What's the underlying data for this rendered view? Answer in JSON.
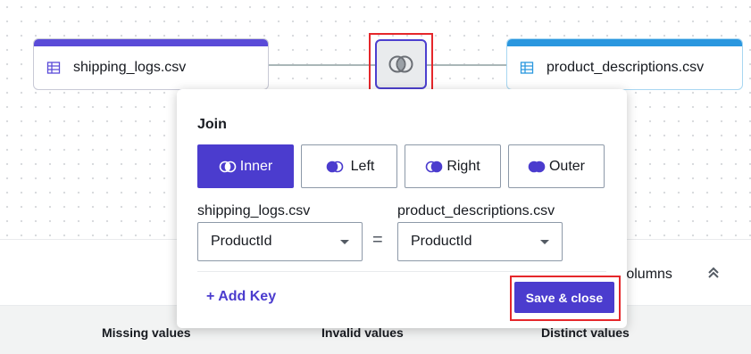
{
  "canvas": {
    "left_node": {
      "name": "shipping_logs.csv",
      "icon": "table-icon"
    },
    "right_node": {
      "name": "product_descriptions.csv",
      "icon": "table-icon"
    },
    "join_icon": "inner-join-icon"
  },
  "background_panel": {
    "columns_text": "d columns",
    "stats": [
      "Missing values",
      "Invalid values",
      "Distinct values"
    ]
  },
  "join_popover": {
    "title": "Join",
    "types": [
      {
        "label": "Inner",
        "selected": true
      },
      {
        "label": "Left",
        "selected": false
      },
      {
        "label": "Right",
        "selected": false
      },
      {
        "label": "Outer",
        "selected": false
      }
    ],
    "left_file": "shipping_logs.csv",
    "right_file": "product_descriptions.csv",
    "left_key": "ProductId",
    "right_key": "ProductId",
    "operator": "=",
    "add_key_label": "+ Add Key",
    "save_label": "Save & close"
  },
  "colors": {
    "accent": "#4b3cce",
    "left_node_bar": "#5a4bd8",
    "right_node_bar": "#2a97df",
    "highlight": "#e5272b"
  }
}
